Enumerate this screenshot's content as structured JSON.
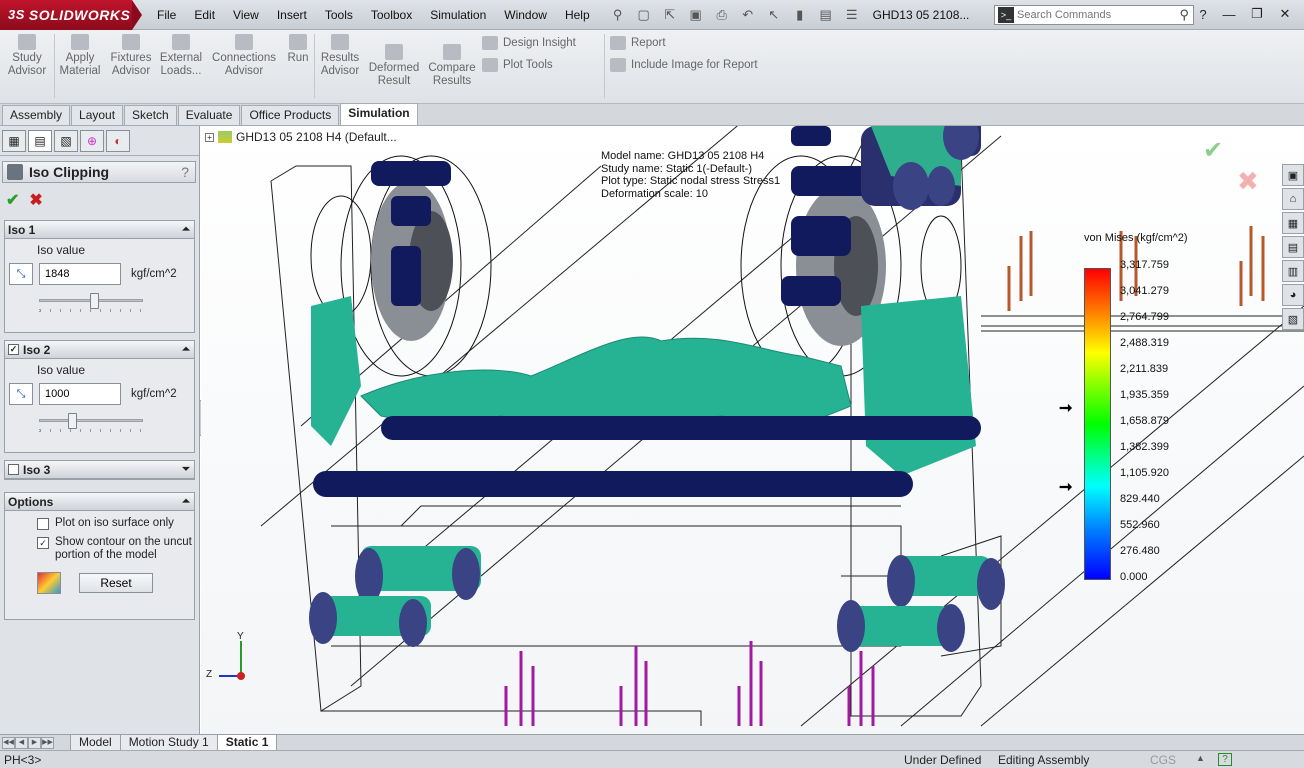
{
  "app": {
    "brand": "SOLIDWORKS",
    "brand_prefix": "3S",
    "document_title": "GHD13 05 2108..."
  },
  "menu": [
    "File",
    "Edit",
    "View",
    "Insert",
    "Tools",
    "Toolbox",
    "Simulation",
    "Window",
    "Help"
  ],
  "search": {
    "placeholder": "Search Commands"
  },
  "command_manager": {
    "study_advisor": "Study Advisor",
    "apply_material": "Apply Material",
    "fixtures_advisor": "Fixtures Advisor",
    "external_loads": "External Loads...",
    "connections_advisor": "Connections Advisor",
    "run": "Run",
    "results_advisor": "Results Advisor",
    "deformed_result": "Deformed Result",
    "compare_results": "Compare Results",
    "design_insight": "Design Insight",
    "plot_tools": "Plot Tools",
    "report": "Report",
    "include_image": "Include Image for Report"
  },
  "tabs": [
    "Assembly",
    "Layout",
    "Sketch",
    "Evaluate",
    "Office Products",
    "Simulation"
  ],
  "active_tab": "Simulation",
  "property_manager": {
    "title": "Iso Clipping",
    "help": "?",
    "iso1": {
      "label": "Iso 1",
      "iso_value_label": "Iso value",
      "value": "1848",
      "unit": "kgf/cm^2",
      "slider_fraction": 0.54
    },
    "iso2": {
      "label": "Iso 2",
      "checked": true,
      "iso_value_label": "Iso value",
      "value": "1000",
      "unit": "kgf/cm^2",
      "slider_fraction": 0.3
    },
    "iso3": {
      "label": "Iso 3"
    },
    "options": {
      "label": "Options",
      "plot_on_iso": "Plot on iso surface only",
      "show_contour": "Show contour on the uncut portion of the model",
      "reset": "Reset"
    }
  },
  "viewport": {
    "tree_item": "GHD13 05 2108 H4  (Default...",
    "annotation": [
      "Model name: GHD13 05 2108 H4",
      "Study name: Static 1(-Default-)",
      "Plot type: Static nodal stress Stress1",
      "Deformation scale: 10"
    ],
    "legend": {
      "title": "von Mises (kgf/cm^2)",
      "values": [
        "3,317.759",
        "3,041.279",
        "2,764.799",
        "2,488.319",
        "2,211.839",
        "1,935.359",
        "1,658.879",
        "1,382.399",
        "1,105.920",
        "829.440",
        "552.960",
        "276.480",
        "0.000"
      ]
    },
    "axis_labels": {
      "z": "Z",
      "y": "Y"
    }
  },
  "bottom_tabs": [
    "Model",
    "Motion Study 1",
    "Static 1"
  ],
  "active_bottom_tab": "Static 1",
  "status": {
    "left": "PH<3>",
    "under_defined": "Under Defined",
    "editing": "Editing Assembly",
    "units": "CGS"
  }
}
